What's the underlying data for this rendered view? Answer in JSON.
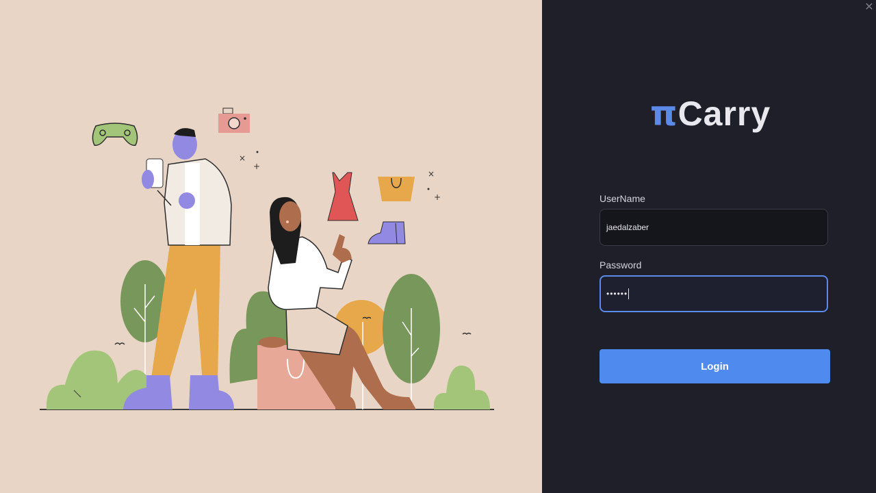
{
  "window": {
    "close_glyph": "✕"
  },
  "brand": {
    "logo_symbol": "π",
    "logo_word": "Carry",
    "accent_color": "#5b8ae8"
  },
  "form": {
    "username_label": "UserName",
    "username_value": "jaedalzaber",
    "password_label": "Password",
    "password_value": "••••••",
    "login_label": "Login",
    "login_color": "#4f8bee"
  },
  "illustration": {
    "description_icons": [
      "game-controller-icon",
      "camera-icon",
      "dress-icon",
      "shopping-bag-icon",
      "shoe-icon"
    ]
  }
}
